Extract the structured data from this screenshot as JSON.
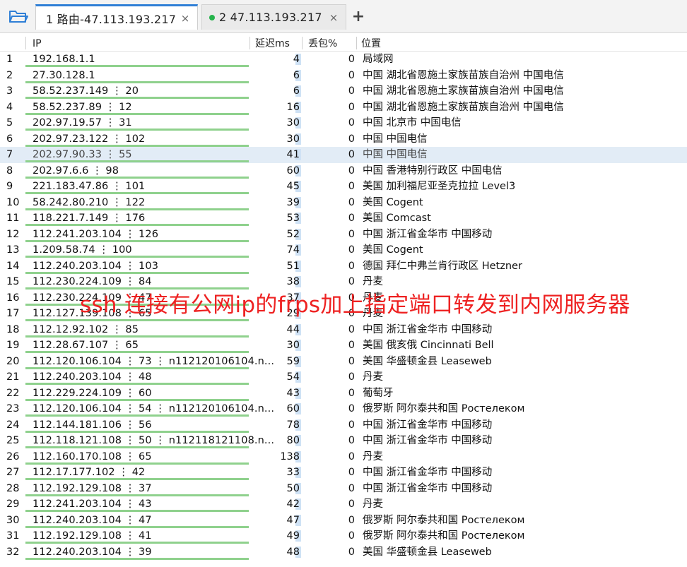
{
  "tabs": [
    {
      "label": "1 路由-47.113.193.217",
      "close": "×"
    },
    {
      "label": "2 47.113.193.217",
      "close": "×"
    }
  ],
  "new_tab_label": "+",
  "columns": {
    "ip": "IP",
    "latency": "延迟ms",
    "loss": "丢包%",
    "location": "位置"
  },
  "rows": [
    {
      "n": "1",
      "ip": "192.168.1.1",
      "lat": "4",
      "loss": "0",
      "loc": "局域网"
    },
    {
      "n": "2",
      "ip": "27.30.128.1",
      "lat": "6",
      "loss": "0",
      "loc": "中国 湖北省恩施土家族苗族自治州 中国电信"
    },
    {
      "n": "3",
      "ip": "58.52.237.149 ⋮ 20",
      "lat": "6",
      "loss": "0",
      "loc": "中国 湖北省恩施土家族苗族自治州 中国电信"
    },
    {
      "n": "4",
      "ip": "58.52.237.89 ⋮ 12",
      "lat": "16",
      "loss": "0",
      "loc": "中国 湖北省恩施土家族苗族自治州 中国电信"
    },
    {
      "n": "5",
      "ip": "202.97.19.57 ⋮ 31",
      "lat": "30",
      "loss": "0",
      "loc": "中国 北京市 中国电信"
    },
    {
      "n": "6",
      "ip": "202.97.23.122 ⋮ 102",
      "lat": "30",
      "loss": "0",
      "loc": "中国  中国电信"
    },
    {
      "n": "7",
      "ip": "202.97.90.33 ⋮ 55",
      "lat": "41",
      "loss": "0",
      "loc": "中国  中国电信"
    },
    {
      "n": "8",
      "ip": "202.97.6.6 ⋮ 98",
      "lat": "60",
      "loss": "0",
      "loc": "中国 香港特别行政区 中国电信"
    },
    {
      "n": "9",
      "ip": "221.183.47.86 ⋮ 101",
      "lat": "45",
      "loss": "0",
      "loc": "美国 加利福尼亚圣克拉拉 Level3"
    },
    {
      "n": "10",
      "ip": "58.242.80.210 ⋮ 122",
      "lat": "39",
      "loss": "0",
      "loc": "美国  Cogent"
    },
    {
      "n": "11",
      "ip": "118.221.7.149 ⋮ 176",
      "lat": "53",
      "loss": "0",
      "loc": "美国  Comcast"
    },
    {
      "n": "12",
      "ip": "112.241.203.104 ⋮ 126",
      "lat": "52",
      "loss": "0",
      "loc": "中国 浙江省金华市 中国移动"
    },
    {
      "n": "13",
      "ip": "1.209.58.74 ⋮ 100",
      "lat": "74",
      "loss": "0",
      "loc": "美国  Cogent"
    },
    {
      "n": "14",
      "ip": "112.240.203.104 ⋮ 103",
      "lat": "51",
      "loss": "0",
      "loc": "德国 拜仁中弗兰肯行政区 Hetzner"
    },
    {
      "n": "15",
      "ip": "112.230.224.109 ⋮ 84",
      "lat": "38",
      "loss": "0",
      "loc": "丹麦"
    },
    {
      "n": "16",
      "ip": "112.230.224.109 ⋮ 47",
      "lat": "37",
      "loss": "0",
      "loc": "丹麦"
    },
    {
      "n": "17",
      "ip": "112.127.139.108 ⋮ 65",
      "lat": "29",
      "loss": "0",
      "loc": "丹麦"
    },
    {
      "n": "18",
      "ip": "112.12.92.102 ⋮ 85",
      "lat": "44",
      "loss": "0",
      "loc": "中国 浙江省金华市 中国移动"
    },
    {
      "n": "19",
      "ip": "112.28.67.107 ⋮ 65",
      "lat": "30",
      "loss": "0",
      "loc": "美国 俄亥俄 Cincinnati Bell"
    },
    {
      "n": "20",
      "ip": "112.120.106.104 ⋮ 73 ⋮ n112120106104.n...",
      "lat": "59",
      "loss": "0",
      "loc": "美国 华盛顿金县 Leaseweb"
    },
    {
      "n": "21",
      "ip": "112.240.203.104 ⋮ 48",
      "lat": "54",
      "loss": "0",
      "loc": "丹麦"
    },
    {
      "n": "22",
      "ip": "112.229.224.109 ⋮ 60",
      "lat": "43",
      "loss": "0",
      "loc": "葡萄牙"
    },
    {
      "n": "23",
      "ip": "112.120.106.104 ⋮ 54 ⋮ n112120106104.n...",
      "lat": "60",
      "loss": "0",
      "loc": "俄罗斯 阿尔泰共和国 Ростелеком"
    },
    {
      "n": "24",
      "ip": "112.144.181.106 ⋮ 56",
      "lat": "78",
      "loss": "0",
      "loc": "中国 浙江省金华市 中国移动"
    },
    {
      "n": "25",
      "ip": "112.118.121.108 ⋮ 50 ⋮ n112118121108.n...",
      "lat": "80",
      "loss": "0",
      "loc": "中国 浙江省金华市 中国移动"
    },
    {
      "n": "26",
      "ip": "112.160.170.108 ⋮ 65",
      "lat": "138",
      "loss": "0",
      "loc": "丹麦"
    },
    {
      "n": "27",
      "ip": "112.17.177.102 ⋮ 42",
      "lat": "33",
      "loss": "0",
      "loc": "中国 浙江省金华市 中国移动"
    },
    {
      "n": "28",
      "ip": "112.192.129.108 ⋮ 37",
      "lat": "50",
      "loss": "0",
      "loc": "中国 浙江省金华市 中国移动"
    },
    {
      "n": "29",
      "ip": "112.241.203.104 ⋮ 43",
      "lat": "42",
      "loss": "0",
      "loc": "丹麦"
    },
    {
      "n": "30",
      "ip": "112.240.203.104 ⋮ 47",
      "lat": "47",
      "loss": "0",
      "loc": "俄罗斯 阿尔泰共和国 Ростелеком"
    },
    {
      "n": "31",
      "ip": "112.192.129.108 ⋮ 41",
      "lat": "49",
      "loss": "0",
      "loc": "俄罗斯 阿尔泰共和国 Ростелеком"
    },
    {
      "n": "32",
      "ip": "112.240.203.104 ⋮ 39",
      "lat": "48",
      "loss": "0",
      "loc": "美国 华盛顿金县 Leaseweb"
    }
  ],
  "selected_row": "7",
  "overlay_text": "ssh 连接有公网ip的frps加上指定端口转发到内网服务器",
  "colors": {
    "accent": "#2f7fd6",
    "status_green": "#25b34b",
    "ip_bar": "#8fd18d",
    "overlay": "#ee2222"
  }
}
